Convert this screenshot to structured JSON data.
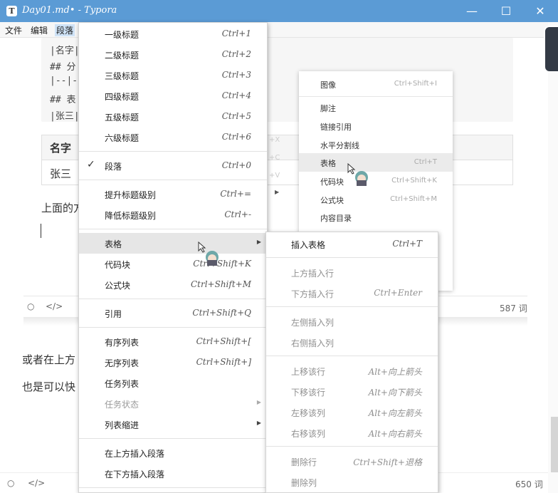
{
  "window": {
    "title": "Day01.md• - Typora",
    "app_icon": "T",
    "minimize_icon": "—",
    "maximize_icon": "☐",
    "close_icon": "✕"
  },
  "menubar": [
    "文件",
    "编辑",
    "段落"
  ],
  "editor": {
    "code_lines": [
      "|名字|",
      "## 分",
      "|--|-",
      "## 表",
      "|张三|"
    ],
    "table_header": "名字",
    "table_cell": "张三",
    "para_1": "上面的方",
    "para_2": "或者在上方",
    "para_3": "也是可以快",
    "inner_word_count": "587 词",
    "word_count": "650 词"
  },
  "context_menu": {
    "items": [
      {
        "label": "图像",
        "shortcut": "Ctrl+Shift+I"
      },
      {
        "label": "脚注",
        "shortcut": ""
      },
      {
        "label": "链接引用",
        "shortcut": ""
      },
      {
        "label": "水平分割线",
        "shortcut": ""
      },
      {
        "label": "表格",
        "shortcut": "Ctrl+T"
      },
      {
        "label": "代码块",
        "shortcut": "Ctrl+Shift+K"
      },
      {
        "label": "公式块",
        "shortcut": "Ctrl+Shift+M"
      },
      {
        "label": "内容目录",
        "shortcut": ""
      }
    ]
  },
  "paragraph_menu": {
    "items": [
      {
        "label": "一级标题",
        "shortcut": "Ctrl+1"
      },
      {
        "label": "二级标题",
        "shortcut": "Ctrl+2"
      },
      {
        "label": "三级标题",
        "shortcut": "Ctrl+3"
      },
      {
        "label": "四级标题",
        "shortcut": "Ctrl+4"
      },
      {
        "label": "五级标题",
        "shortcut": "Ctrl+5"
      },
      {
        "label": "六级标题",
        "shortcut": "Ctrl+6"
      },
      {
        "label": "段落",
        "shortcut": "Ctrl+0",
        "checked": true
      },
      {
        "label": "提升标题级别",
        "shortcut": "Ctrl+="
      },
      {
        "label": "降低标题级别",
        "shortcut": "Ctrl+-"
      },
      {
        "label": "表格",
        "shortcut": "",
        "submenu": true,
        "highlighted": true
      },
      {
        "label": "代码块",
        "shortcut": "Ctrl+Shift+K"
      },
      {
        "label": "公式块",
        "shortcut": "Ctrl+Shift+M"
      },
      {
        "label": "引用",
        "shortcut": "Ctrl+Shift+Q"
      },
      {
        "label": "有序列表",
        "shortcut": "Ctrl+Shift+["
      },
      {
        "label": "无序列表",
        "shortcut": "Ctrl+Shift+]"
      },
      {
        "label": "任务列表",
        "shortcut": ""
      },
      {
        "label": "任务状态",
        "shortcut": "",
        "submenu": true,
        "disabled": true
      },
      {
        "label": "列表缩进",
        "shortcut": "",
        "submenu": true
      },
      {
        "label": "在上方插入段落",
        "shortcut": ""
      },
      {
        "label": "在下方插入段落",
        "shortcut": ""
      }
    ]
  },
  "table_submenu": {
    "items": [
      {
        "label": "插入表格",
        "shortcut": "Ctrl+T",
        "disabled": false
      },
      {
        "label": "上方插入行",
        "shortcut": "",
        "disabled": true
      },
      {
        "label": "下方插入行",
        "shortcut": "Ctrl+Enter",
        "disabled": true
      },
      {
        "label": "左侧插入列",
        "shortcut": "",
        "disabled": true
      },
      {
        "label": "右侧插入列",
        "shortcut": "",
        "disabled": true
      },
      {
        "label": "上移该行",
        "shortcut": "Alt+向上箭头",
        "disabled": true
      },
      {
        "label": "下移该行",
        "shortcut": "Alt+向下箭头",
        "disabled": true
      },
      {
        "label": "左移该列",
        "shortcut": "Alt+向左箭头",
        "disabled": true
      },
      {
        "label": "右移该列",
        "shortcut": "Alt+向右箭头",
        "disabled": true
      },
      {
        "label": "删除行",
        "shortcut": "Ctrl+Shift+退格",
        "disabled": true
      },
      {
        "label": "删除列",
        "shortcut": "",
        "disabled": true
      }
    ]
  },
  "icons": {
    "check": "✓",
    "submenu_arrow": "▶",
    "status_circle": "○",
    "source_code": "</>"
  },
  "colors": {
    "titlebar": "#5b9bd5",
    "menu_highlight": "#e6e6e6"
  }
}
